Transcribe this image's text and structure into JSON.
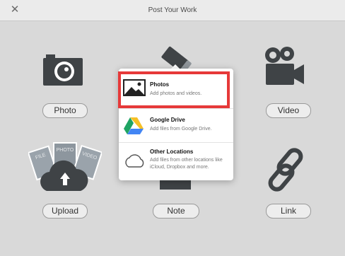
{
  "window": {
    "title": "Post Your Work",
    "close_glyph": "✕"
  },
  "tiles": {
    "photo": {
      "label": "Photo",
      "icon": "camera-icon"
    },
    "video": {
      "label": "Video",
      "icon": "video-camera-icon"
    },
    "upload": {
      "label": "Upload",
      "icon": "cloud-upload-icon",
      "card_labels": [
        "FILE",
        "PHOTO",
        "VIDEO"
      ]
    },
    "note": {
      "label": "Note",
      "icon": "pencil-icon"
    },
    "link": {
      "label": "Link",
      "icon": "link-icon"
    }
  },
  "menu": {
    "options": [
      {
        "title": "Photos",
        "subtitle": "Add photos and videos.",
        "icon": "image-icon",
        "highlighted": true
      },
      {
        "title": "Google Drive",
        "subtitle": "Add files from Google Drive.",
        "icon": "google-drive-icon"
      },
      {
        "title": "Other Locations",
        "subtitle": "Add files from other locations like iCloud, Dropbox and more.",
        "icon": "cloud-icon"
      }
    ]
  },
  "colors": {
    "highlight": "#e63939",
    "icon": "#3f4346",
    "panel": "#d9d9d9"
  }
}
